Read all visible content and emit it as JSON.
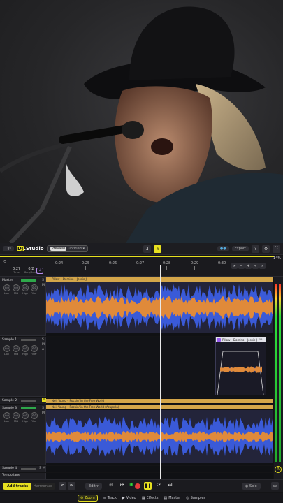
{
  "app": {
    "name": "DJ.Studio",
    "project": "Untitled",
    "badge": "Preview",
    "zoom_pct": "14%"
  },
  "topbar": {
    "left_pill": "DJs",
    "export": "Export",
    "logo_text": "DJ.Studio"
  },
  "ruler": {
    "times": [
      "0:24",
      "0:25",
      "0:26",
      "0:27",
      "0:28",
      "0:29",
      "0:30"
    ],
    "tempo_a": "0:27",
    "tempo_b": "0/2",
    "tempo_a_lbl": "Time",
    "tempo_b_lbl": "Bars/Beats"
  },
  "tracks": {
    "master": {
      "name": "Master",
      "clip": "Pillow – Domino – Jessie J"
    },
    "sample1": {
      "name": "Sample 1",
      "clip": "Pillow – Domino – Jessie J",
      "clip_badge": "5A"
    },
    "sample2": {
      "name": "Sample 2",
      "clip": "Neil Young – Rockin' in the Free World"
    },
    "sample3": {
      "name": "Sample 3",
      "clip": "Neil Young – Rockin' in the Free World (Acapella)"
    },
    "sample4": {
      "name": "Sample 4"
    },
    "tempo": {
      "name": "Tempo lane"
    }
  },
  "knobs": {
    "labels": [
      "Low",
      "Mid",
      "High",
      "Filter"
    ],
    "value": "0.0"
  },
  "bottom": {
    "add_tracks": "Add tracks",
    "harmonize": "Harmonize",
    "edit": "Edit",
    "solo": "Solo"
  },
  "nav": [
    "Zoom",
    "Track",
    "Video",
    "Effects",
    "Master",
    "Samples"
  ],
  "colors": {
    "accent": "#e6e020",
    "waveform_blue": "#3a5ad8",
    "waveform_orange": "#e08a3a",
    "clip_gold": "#d4a64a"
  }
}
